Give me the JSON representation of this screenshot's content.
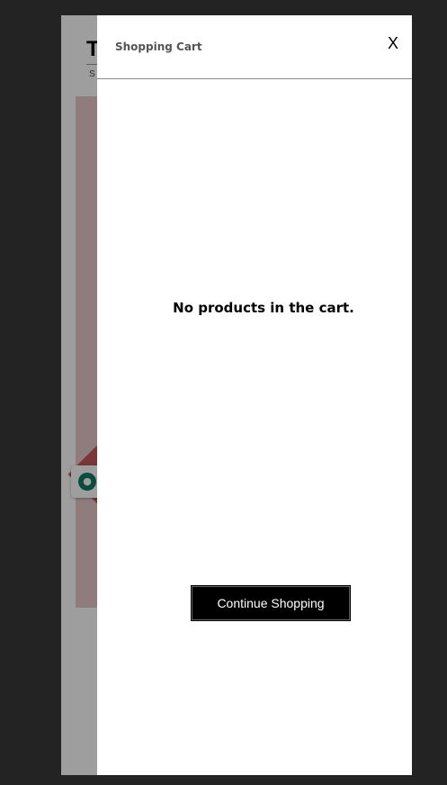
{
  "background_page": {
    "title_initial": "T",
    "subtitle_initial": "S",
    "chip_icon": "palette-icon"
  },
  "cart": {
    "title": "Shopping Cart",
    "close_label": "X",
    "empty_message": "No products in the cart.",
    "continue_label": "Continue Shopping"
  },
  "colors": {
    "page_background": "#232323",
    "drawer_background": "#ffffff",
    "button_background": "#000000",
    "button_text": "#ffffff",
    "title_text": "#555555"
  }
}
